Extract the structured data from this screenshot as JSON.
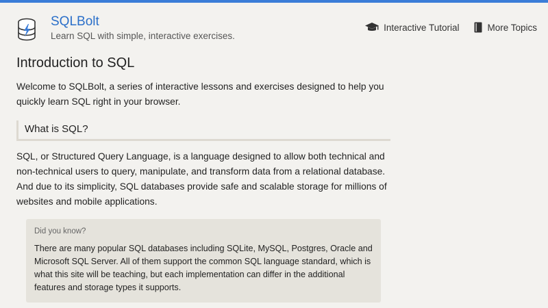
{
  "header": {
    "brand_sql": "SQL",
    "brand_bolt": "Bolt",
    "tagline": "Learn SQL with simple, interactive exercises.",
    "nav": [
      {
        "label": "Interactive Tutorial",
        "icon": "graduation-cap-icon"
      },
      {
        "label": "More Topics",
        "icon": "book-icon"
      }
    ]
  },
  "main": {
    "title": "Introduction to SQL",
    "intro": "Welcome to SQLBolt, a series of interactive lessons and exercises designed to help you quickly learn SQL right in your browser.",
    "section_heading": "What is SQL?",
    "body": "SQL, or Structured Query Language, is a language designed to allow both technical and non-technical users to query, manipulate, and transform data from a relational database. And due to its simplicity, SQL databases provide safe and scalable storage for millions of websites and mobile applications.",
    "callout": {
      "title": "Did you know?",
      "text": "There are many popular SQL databases including SQLite, MySQL, Postgres, Oracle and Microsoft SQL Server. All of them support the common SQL language standard, which is what this site will be teaching, but each implementation can differ in the additional features and storage types it supports."
    }
  },
  "colors": {
    "accent": "#3b7dd8",
    "brand": "#2a6fc9",
    "background": "#f3f2ef",
    "callout_bg": "#e5e3dc"
  }
}
